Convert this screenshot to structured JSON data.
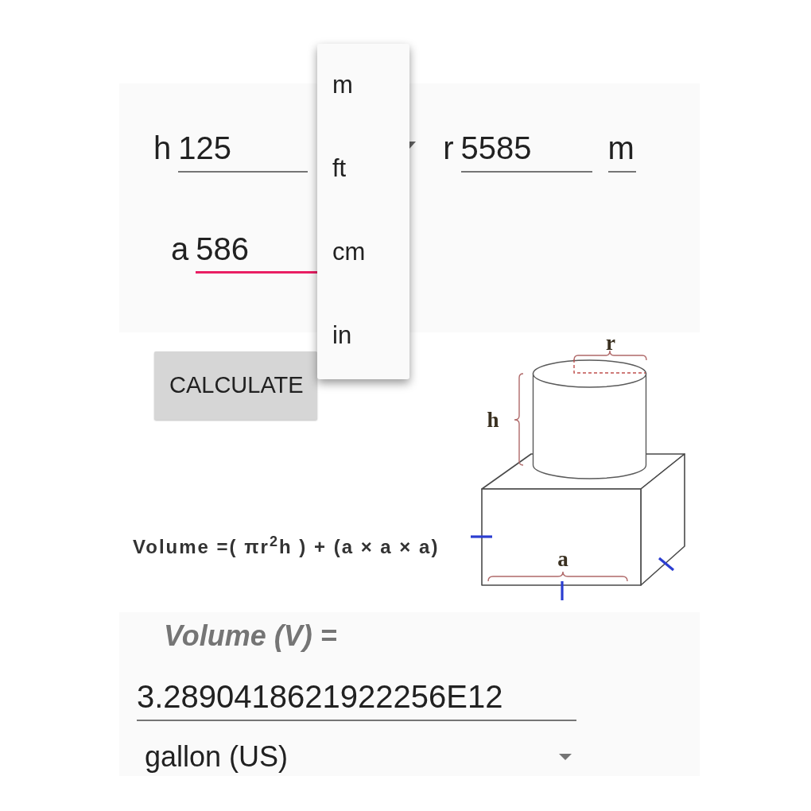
{
  "form": {
    "rows": [
      [
        {
          "kind": "input",
          "label": "h",
          "value": "125",
          "focused": false
        },
        {
          "kind": "dropdown"
        },
        {
          "kind": "input",
          "label": "r",
          "value": "5585",
          "focused": false
        },
        {
          "kind": "unit",
          "value": "m"
        }
      ],
      [
        {
          "kind": "input",
          "label": "a",
          "value": "586",
          "focused": true
        }
      ]
    ]
  },
  "menu": {
    "items": [
      "m",
      "ft",
      "cm",
      "in"
    ]
  },
  "calculate_button": {
    "label": "CALCULATE"
  },
  "diagram": {
    "formula": "Volume =( πr$^{2}$h ) + (a × a × a)",
    "labels": [
      {
        "kind": "radius",
        "text": "r"
      },
      {
        "kind": "height",
        "text": "h"
      },
      {
        "kind": "side",
        "text": "a"
      }
    ]
  },
  "result": {
    "title": "Volume (V) =",
    "value": "3.2890418621922256E12",
    "unit": "gallon (US)"
  }
}
